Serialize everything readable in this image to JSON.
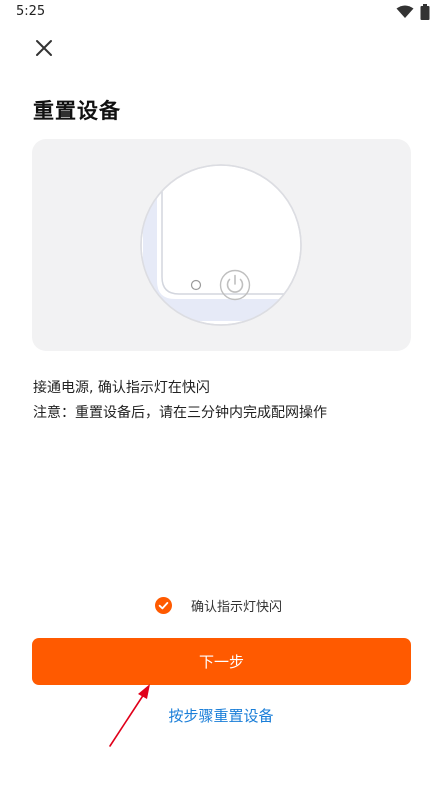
{
  "status_bar": {
    "time": "5:25",
    "icons": [
      "wifi-icon",
      "battery-icon"
    ]
  },
  "header": {
    "close_icon": "close-icon"
  },
  "page": {
    "title": "重置设备"
  },
  "illustration": {
    "icon": "power-icon"
  },
  "instructions": {
    "line1": "接通电源, 确认指示灯在快闪",
    "line2": "注意：重置设备后，请在三分钟内完成配网操作"
  },
  "confirm": {
    "checked": true,
    "label": "确认指示灯快闪"
  },
  "actions": {
    "next_label": "下一步",
    "step_reset_link": "按步骤重置设备"
  },
  "colors": {
    "accent": "#ff5a00",
    "link": "#1a7ed8",
    "card_bg": "#f2f2f3",
    "annotation": "#e0001a"
  }
}
